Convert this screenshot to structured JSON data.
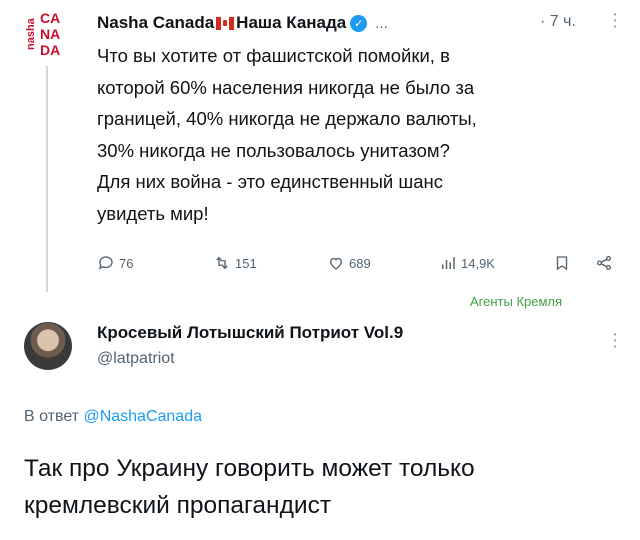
{
  "tweet1": {
    "logo_side_text": "nasha",
    "logo_rows": [
      "CA",
      "NA",
      "DA"
    ],
    "display_name": "Nasha Canada",
    "display_name_suffix": "Наша Канада",
    "ellipsis": "...",
    "time": "· 7 ч.",
    "more": "⋮",
    "body": "Что вы хотите от фашистской помойки, в\nкоторой 60% населения никогда не было за\nграницей, 40% никогда не держало валюты,\n30% никогда не пользовалось унитазом?\nДля них война - это единственный шанс\nувидеть мир!",
    "actions": {
      "replies": "76",
      "retweets": "151",
      "likes": "689",
      "views": "14,9K"
    }
  },
  "watermark": "Агенты Кремля",
  "tweet2": {
    "display_name": "Кросевый Лотышский Потриот Vol.9",
    "handle": "@latpatriot",
    "more": "⋮",
    "reply_prefix": "В ответ ",
    "reply_handle": "@NashaCanada",
    "body": "Так про Украину говорить может только\nкремлевский пропагандист"
  },
  "colors": {
    "accent": "#1d9bf0",
    "logo_red": "#c8102e",
    "secondary_text": "#536471",
    "watermark": "#43a047"
  }
}
